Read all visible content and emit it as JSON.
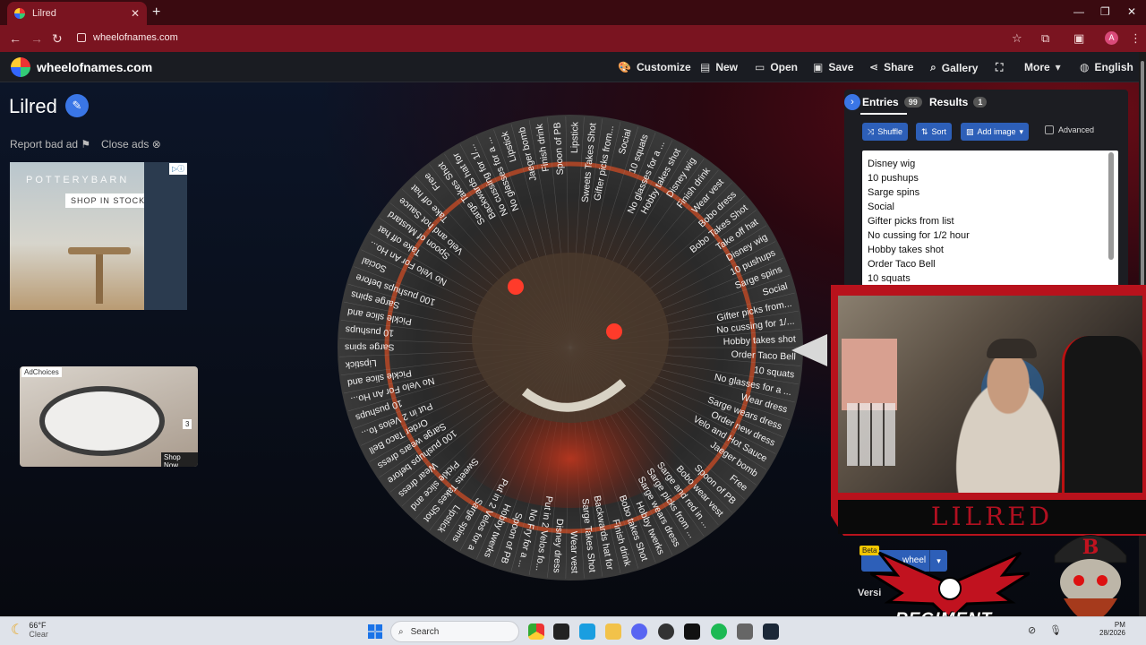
{
  "browser": {
    "tab_title": "Lilred",
    "new_tab": "+",
    "url": "wheelofnames.com",
    "avatar_letter": "A"
  },
  "header": {
    "brand": "wheelofnames.com",
    "buttons": [
      "Customize",
      "New",
      "Open",
      "Save",
      "Share",
      "Gallery",
      "More",
      "English"
    ]
  },
  "page": {
    "title": "Lilred",
    "report_bad_ad": "Report bad ad",
    "close_ads": "Close ads"
  },
  "ads": {
    "ad1_brand": "POTTERYBARN",
    "ad1_cta": "SHOP IN STOCK",
    "ad2_label": "AdChoices",
    "ad2_count": "3",
    "ad2_shop": "Shop Now"
  },
  "wheel": {
    "slices": [
      "Order Taco Bell",
      "10 squats",
      "No glasses for a ...",
      "Wear dress",
      "Sarge wears dress",
      "Order new dress",
      "Velo and Hot Sauce",
      "Jaeger bomb",
      "Free",
      "Spoon of PB",
      "Bobo wear vest",
      "Sarge and red in ...",
      "Sarge picks from ...",
      "Sarge wears dress",
      "Hobby twerks",
      "Bobo takes Shot",
      "Finish drink",
      "Backwards hat for",
      "Sarge Takes Shot",
      "Wear vest",
      "Disney dress",
      "Put in 2 Velos fo...",
      "No Fry for a ...",
      "Spoon of PB",
      "Hobby twerks",
      "Put in 2 Velos for a",
      "Sarge spins",
      "Lipstick",
      "Sweets Takes Shot",
      "Pickle slice and",
      "Wear dress",
      "100 pushups before",
      "Sarge wears dress",
      "Order Taco Bell",
      "Put in 2 Velos fo...",
      "10 pushups",
      "No Velo For An Ho...",
      "Pickle slice and",
      "Lipstick",
      "Sarge spins",
      "10 pushups",
      "Pickle slice and",
      "Sarge spins",
      "100 pushups before",
      "Social",
      "No Velo For An Ho...",
      "Take off hat",
      "Spoon of Mustard",
      "Velo and hot Sauce",
      "Take off hat",
      "Free",
      "Sarge Takes Shot",
      "Backwards hat for",
      "No cussing for 1/...",
      "No glasses for a ...",
      "Lipstick",
      "Jaeger bomb",
      "Finish drink",
      "Spoon of PB",
      "Lipstick",
      "Sweets Takes Shot",
      "Gifter picks from...",
      "Social",
      "10 squats",
      "No glasses for a ...",
      "Hobby takes shot",
      "Disney wig",
      "Finish drink",
      "Wear vest",
      "Bobo dress",
      "Bobo Takes Shot",
      "Take off hat",
      "Disney wig",
      "10 pushups",
      "Sarge spins",
      "Social",
      "Gifter picks from...",
      "No cussing for 1/...",
      "Hobby takes shot"
    ]
  },
  "panel": {
    "entries_label": "Entries",
    "entries_count": "99",
    "results_label": "Results",
    "results_count": "1",
    "shuffle": "Shuffle",
    "sort": "Sort",
    "add_image": "Add image",
    "advanced": "Advanced",
    "entries": [
      "Disney wig",
      "10 pushups",
      "Sarge spins",
      "Social",
      "Gifter picks from list",
      "No cussing for 1/2 hour",
      "Hobby takes shot",
      "Order Taco Bell",
      "10 squats"
    ]
  },
  "overlay": {
    "streamer_name": "LILRED",
    "beta": "Beta",
    "spin_label": "wheel",
    "version_label": "Versi",
    "regiment": "REGIMENT"
  },
  "taskbar": {
    "temp": "66°F",
    "condition": "Clear",
    "search": "Search",
    "time": "PM",
    "date": "28/2026"
  },
  "colors": {
    "accent": "#3a76e6",
    "browser_frame": "#7a1420",
    "stream_red": "#b8121c"
  }
}
